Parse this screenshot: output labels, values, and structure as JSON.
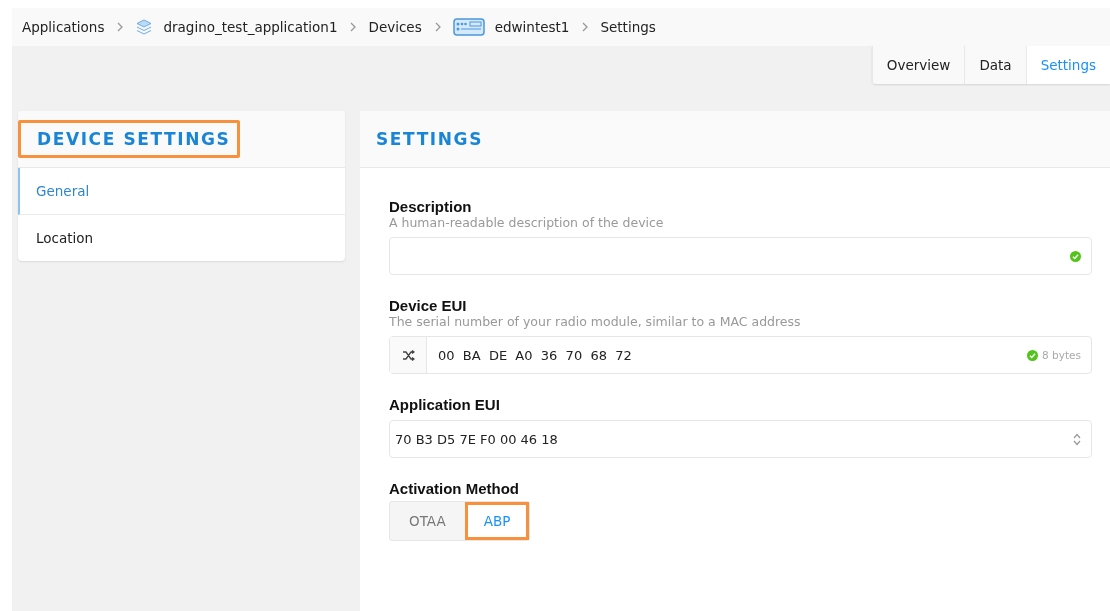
{
  "breadcrumb": [
    {
      "label": "Applications",
      "kind": "list"
    },
    {
      "label": "dragino_test_application1",
      "kind": "application"
    },
    {
      "label": "Devices",
      "kind": "list"
    },
    {
      "label": "edwintest1",
      "kind": "device"
    },
    {
      "label": "Settings",
      "kind": "page"
    }
  ],
  "tabs": [
    {
      "label": "Overview",
      "selected": false
    },
    {
      "label": "Data",
      "selected": false
    },
    {
      "label": "Settings",
      "selected": true
    }
  ],
  "side_panel": {
    "title": "DEVICE SETTINGS",
    "highlighted": true,
    "items": [
      {
        "label": "General",
        "selected": true
      },
      {
        "label": "Location",
        "selected": false
      }
    ]
  },
  "settings": {
    "title": "SETTINGS",
    "fields": [
      {
        "kind": "text",
        "label": "Description",
        "hint": "A human-readable description of the device",
        "valid": true
      },
      {
        "kind": "eui",
        "label": "Device EUI",
        "hint": "The serial number of your radio module, similar to a MAC address",
        "value": "00  BA  DE  A0  36  70  68  72",
        "badge": "8 bytes",
        "valid": true
      },
      {
        "kind": "select",
        "label": "Application EUI",
        "value": "70 B3 D5 7E F0 00 46 18"
      },
      {
        "kind": "choice",
        "label": "Activation Method",
        "options": [
          {
            "label": "OTAA",
            "selected": false,
            "highlighted": false
          },
          {
            "label": "ABP",
            "selected": true,
            "highlighted": true
          }
        ]
      }
    ]
  }
}
